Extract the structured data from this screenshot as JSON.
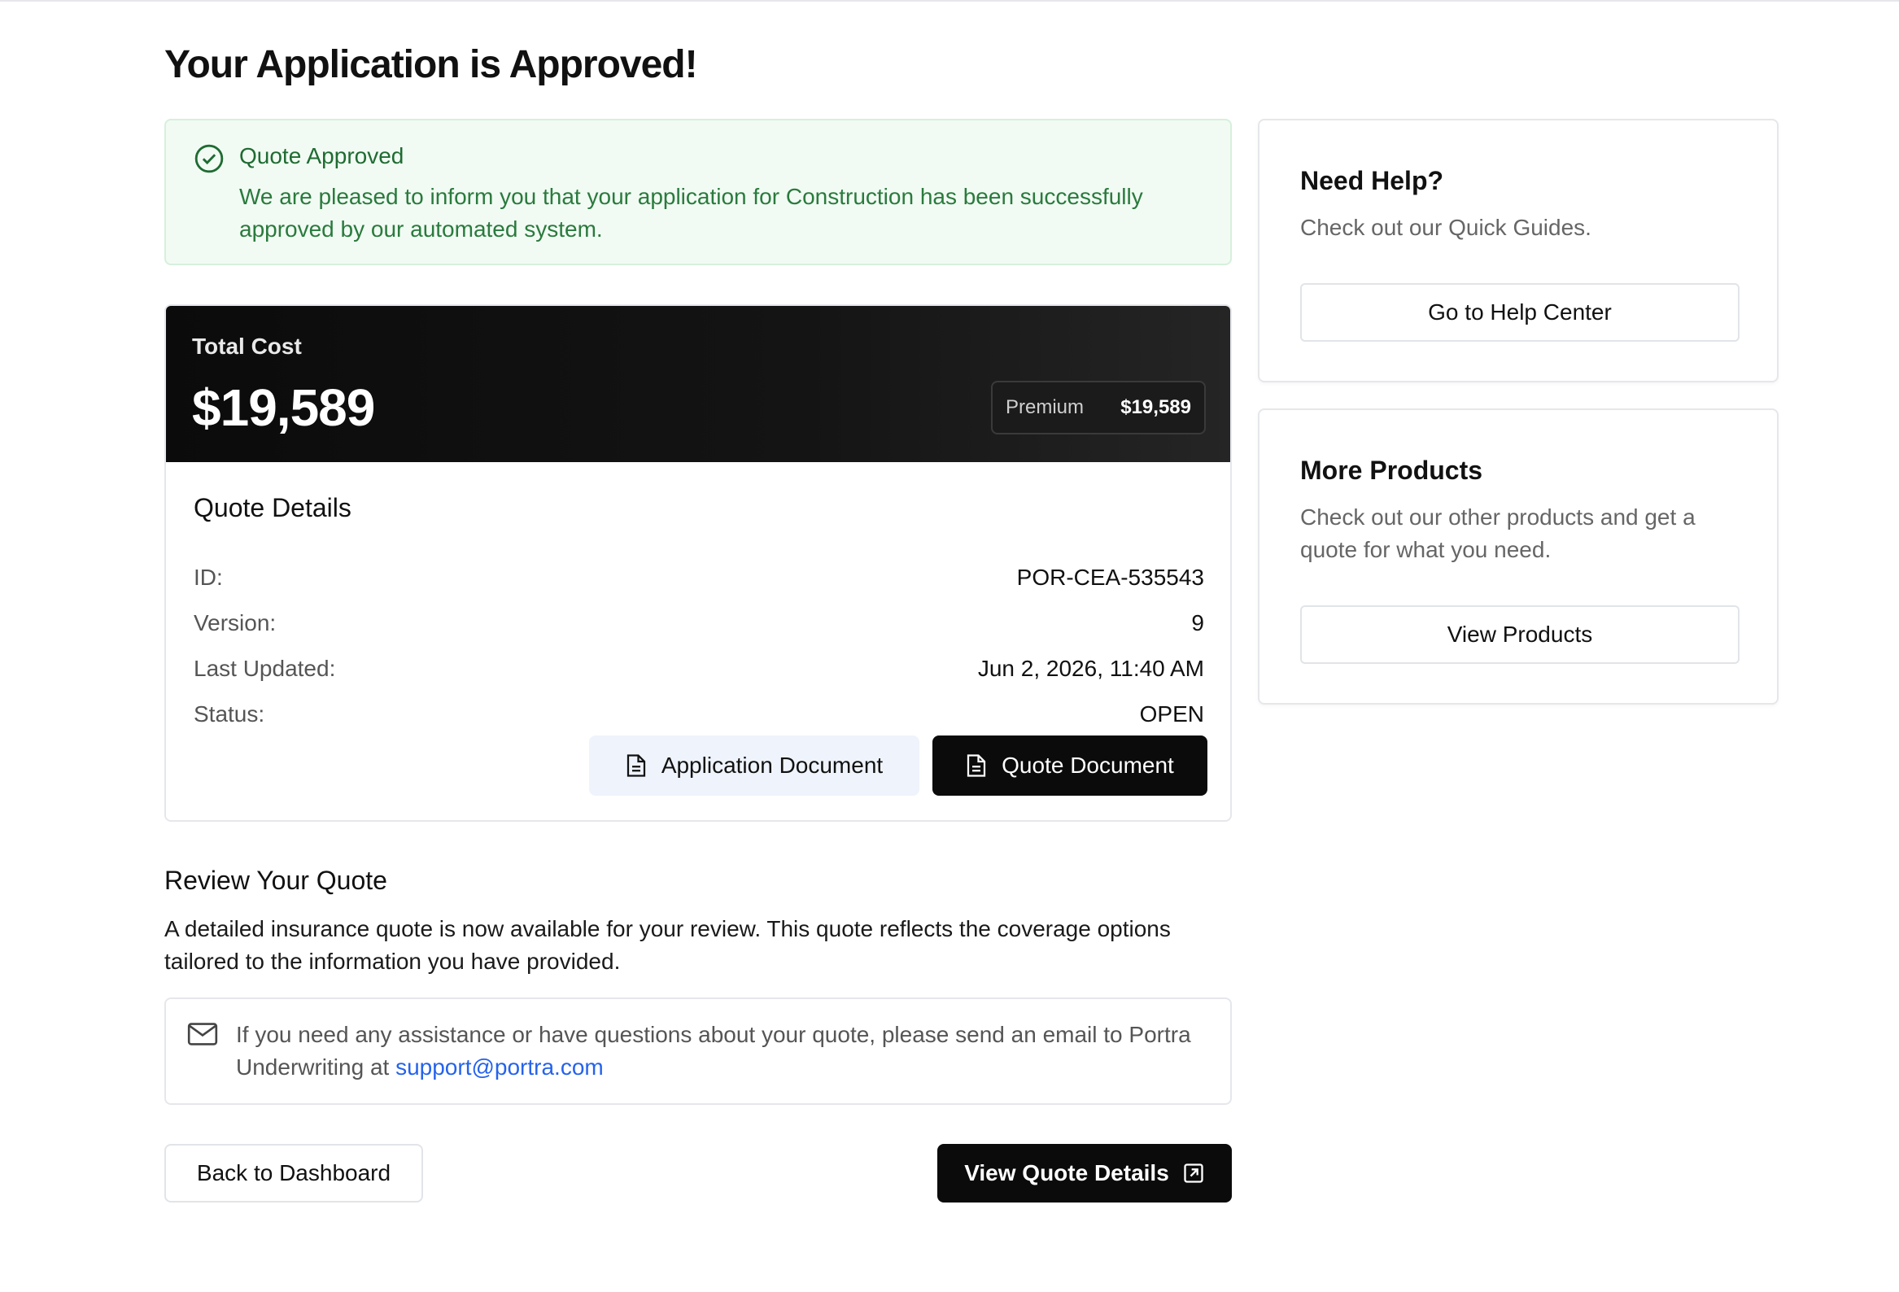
{
  "page": {
    "title": "Your Application is Approved!"
  },
  "alert": {
    "title": "Quote Approved",
    "message": "We are pleased to inform you that your application for Construction has been successfully approved by our automated system.",
    "icon": "check-circle-icon",
    "color": "#1f6b32"
  },
  "cost": {
    "label": "Total Cost",
    "value": "$19,589",
    "premium_label": "Premium",
    "premium_value": "$19,589"
  },
  "quote_details": {
    "title": "Quote Details",
    "rows": [
      {
        "label": "ID:",
        "value": "POR-CEA-535543"
      },
      {
        "label": "Version:",
        "value": "9"
      },
      {
        "label": "Last Updated:",
        "value": "Jun 2, 2026, 11:40 AM"
      },
      {
        "label": "Status:",
        "value": "OPEN"
      }
    ],
    "application_document_label": "Application Document",
    "quote_document_label": "Quote Document"
  },
  "review": {
    "title": "Review Your Quote",
    "body": "A detailed insurance quote is now available for your review. This quote reflects the coverage options tailored to the information you have provided.",
    "email_text": "If you need any assistance or have questions about your quote, please send an email to Portra Underwriting at",
    "email_link": "support@portra.com"
  },
  "actions": {
    "back_label": "Back to Dashboard",
    "view_label": "View Quote Details"
  },
  "sidebar": {
    "help": {
      "title": "Need Help?",
      "text": "Check out our Quick Guides.",
      "button": "Go to Help Center"
    },
    "products": {
      "title": "More Products",
      "text": "Check out our other products and get a quote for what you need.",
      "button": "View Products"
    }
  },
  "colors": {
    "accent_dark": "#0b0b0b",
    "success_bg": "#f1fbf3",
    "link": "#2563eb"
  }
}
